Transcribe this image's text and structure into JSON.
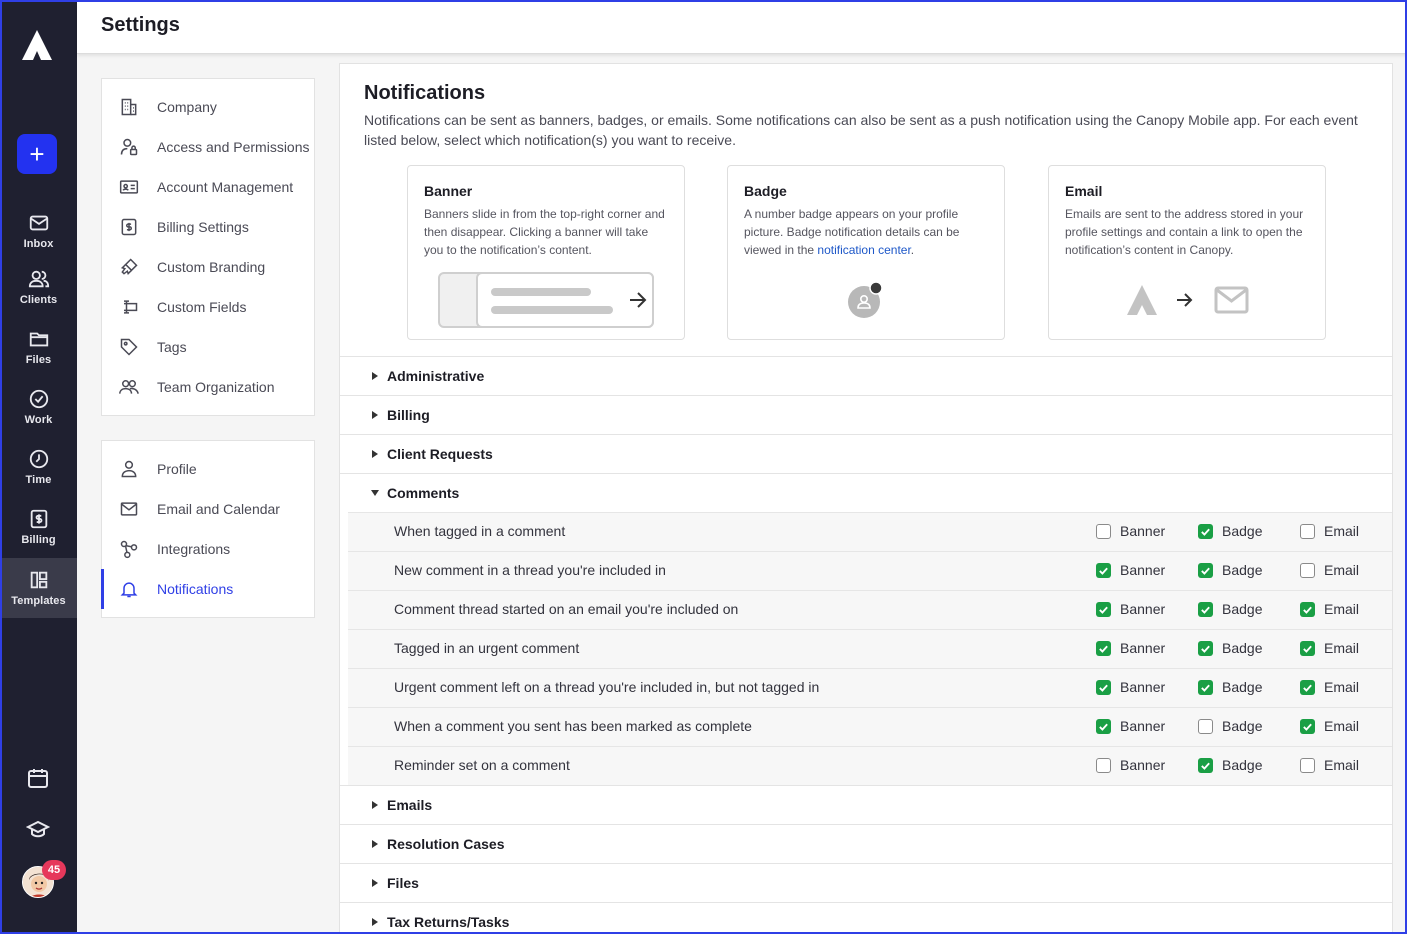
{
  "header": {
    "title": "Settings"
  },
  "rail": {
    "items": [
      {
        "label": "Inbox",
        "icon": "mail-icon"
      },
      {
        "label": "Clients",
        "icon": "people-icon"
      },
      {
        "label": "Files",
        "icon": "folder-icon"
      },
      {
        "label": "Work",
        "icon": "check-circle-icon"
      },
      {
        "label": "Time",
        "icon": "clock-icon"
      },
      {
        "label": "Billing",
        "icon": "dollar-icon"
      },
      {
        "label": "Templates",
        "icon": "templates-icon"
      }
    ],
    "avatar_badge": "45"
  },
  "firm_menu": [
    {
      "label": "Company",
      "icon": "building-icon"
    },
    {
      "label": "Access and Permissions",
      "icon": "user-lock-icon"
    },
    {
      "label": "Account Management",
      "icon": "id-card-icon"
    },
    {
      "label": "Billing Settings",
      "icon": "dollar-icon"
    },
    {
      "label": "Custom Branding",
      "icon": "paintbrush-icon"
    },
    {
      "label": "Custom Fields",
      "icon": "custom-field-icon"
    },
    {
      "label": "Tags",
      "icon": "tag-icon"
    },
    {
      "label": "Team Organization",
      "icon": "team-icon"
    }
  ],
  "user_menu": [
    {
      "label": "Profile",
      "icon": "person-icon"
    },
    {
      "label": "Email and Calendar",
      "icon": "mail-icon"
    },
    {
      "label": "Integrations",
      "icon": "integrations-icon"
    },
    {
      "label": "Notifications",
      "icon": "bell-icon",
      "active": true
    }
  ],
  "main": {
    "title": "Notifications",
    "description": "Notifications can be sent as banners, badges, or emails. Some notifications can also be sent as a push notification using the Canopy Mobile app. For each event listed below, select which notification(s) you want to receive.",
    "cards": {
      "banner": {
        "title": "Banner",
        "text": "Banners slide in from the top-right corner and then disappear. Clicking a banner will take you to the notification’s content."
      },
      "badge": {
        "title": "Badge",
        "text_before": "A number badge appears on your profile picture. Badge notification details can be viewed in the ",
        "link": "notification center",
        "text_after": "."
      },
      "email": {
        "title": "Email",
        "text": "Emails are sent to the address stored in your profile settings and contain a link to open the notification’s content in Canopy."
      }
    },
    "sections": [
      {
        "title": "Administrative",
        "expanded": false
      },
      {
        "title": "Billing",
        "expanded": false
      },
      {
        "title": "Client Requests",
        "expanded": false
      },
      {
        "title": "Comments",
        "expanded": true
      },
      {
        "title": "Emails",
        "expanded": false
      },
      {
        "title": "Resolution Cases",
        "expanded": false
      },
      {
        "title": "Files",
        "expanded": false
      },
      {
        "title": "Tax Returns/Tasks",
        "expanded": false
      }
    ],
    "option_labels": {
      "banner": "Banner",
      "badge": "Badge",
      "email": "Email"
    },
    "comment_rows": [
      {
        "label": "When tagged in a comment",
        "banner": false,
        "badge": true,
        "email": false
      },
      {
        "label": "New comment in a thread you're included in",
        "banner": true,
        "badge": true,
        "email": false
      },
      {
        "label": "Comment thread started on an email you're included on",
        "banner": true,
        "badge": true,
        "email": true
      },
      {
        "label": "Tagged in an urgent comment",
        "banner": true,
        "badge": true,
        "email": true
      },
      {
        "label": "Urgent comment left on a thread you're included in, but not tagged in",
        "banner": true,
        "badge": true,
        "email": true
      },
      {
        "label": "When a comment you sent has been marked as complete",
        "banner": true,
        "badge": false,
        "email": true
      },
      {
        "label": "Reminder set on a comment",
        "banner": false,
        "badge": true,
        "email": false
      }
    ],
    "colors": {
      "accent": "#2f3fe6",
      "checked": "#1a9f45",
      "rail": "#1f2030"
    }
  }
}
